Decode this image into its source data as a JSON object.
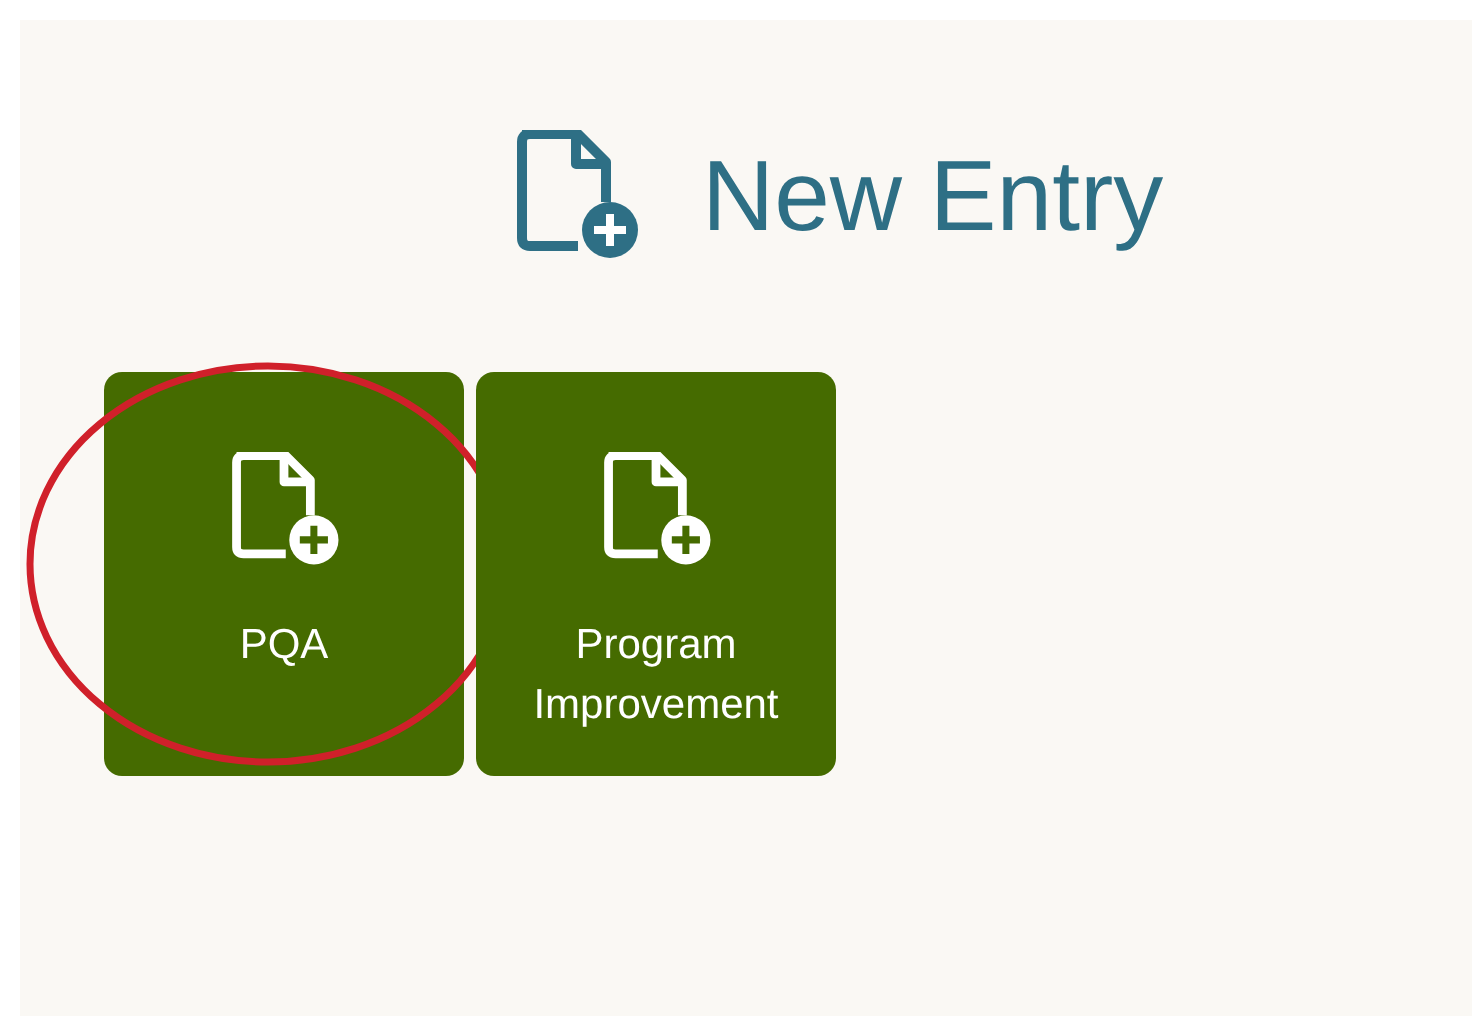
{
  "header": {
    "title": "New Entry"
  },
  "tiles": [
    {
      "label": "PQA",
      "circled": true
    },
    {
      "label": "Program Improvement",
      "circled": false
    }
  ]
}
